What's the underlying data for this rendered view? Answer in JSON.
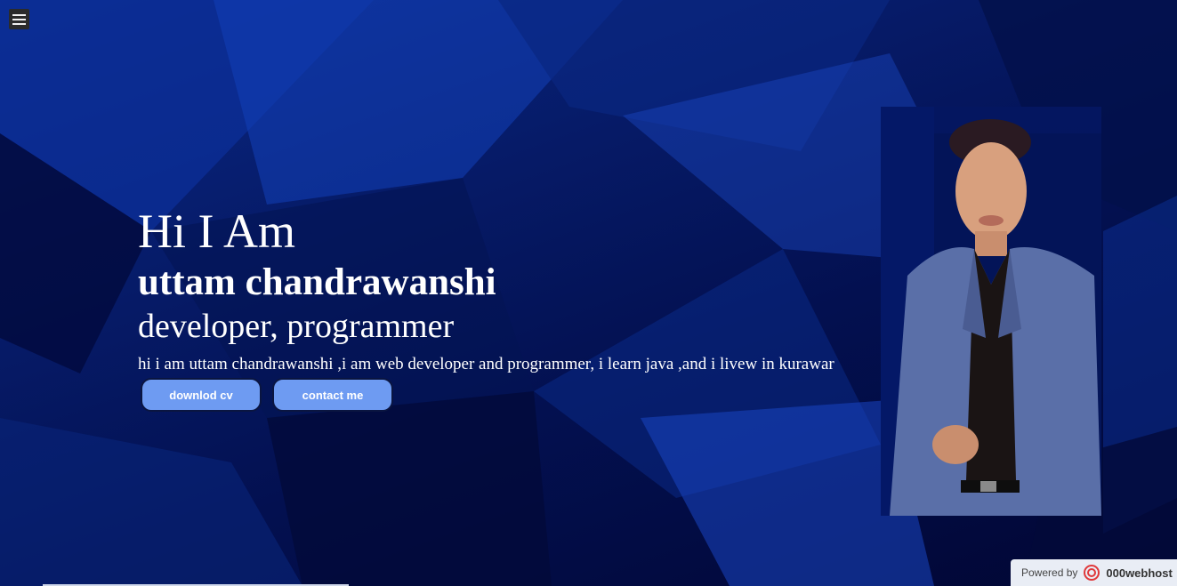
{
  "nav": {
    "menu_icon": "hamburger-icon"
  },
  "hero": {
    "greeting": "Hi I Am",
    "name": "uttam chandrawanshi",
    "role": "developer, programmer",
    "bio": "hi i am uttam chandrawanshi ,i am web developer and programmer, i learn java ,and i livew in kurawar",
    "buttons": {
      "download_cv": "downlod cv",
      "contact_me": "contact me"
    }
  },
  "footer_badge": {
    "powered_by": "Powered by",
    "brand": "000webhost",
    "logo_icon": "000webhost-logo-icon"
  },
  "colors": {
    "background": "#020b3a",
    "button": "#6e9bf2",
    "text": "#ffffff"
  }
}
